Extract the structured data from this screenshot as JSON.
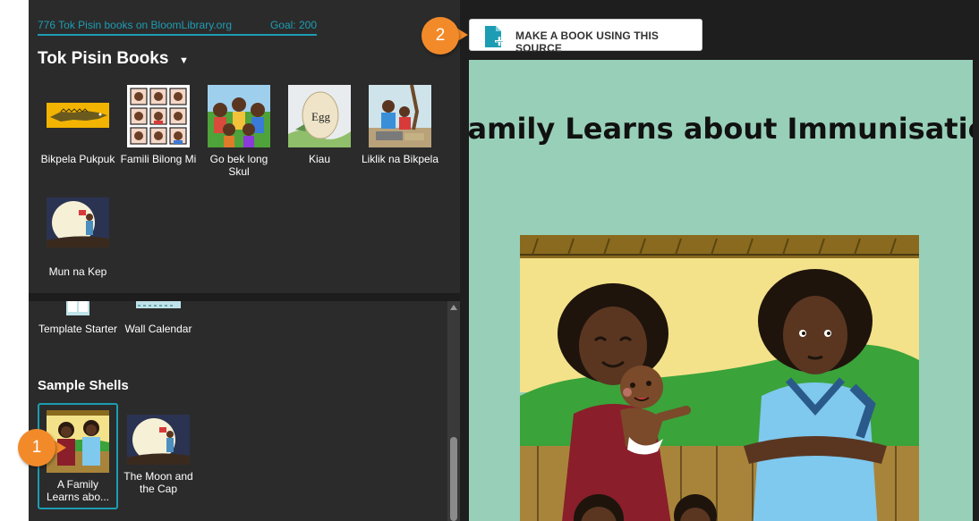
{
  "stats": {
    "count_text": "776 Tok Pisin books on BloomLibrary.org",
    "goal_text": "Goal: 200"
  },
  "collection": {
    "title": "Tok Pisin Books",
    "books": [
      {
        "label": "Bikpela Pukpuk"
      },
      {
        "label": "Famili Bilong Mi"
      },
      {
        "label": "Go bek long Skul"
      },
      {
        "label": "Kiau"
      },
      {
        "label": "Liklik na Bikpela"
      },
      {
        "label": "Mun na Kep"
      }
    ]
  },
  "templates": {
    "items": [
      {
        "label": "Template Starter"
      },
      {
        "label": "Wall Calendar"
      }
    ]
  },
  "shells": {
    "title": "Sample Shells",
    "items": [
      {
        "label": "A Family Learns abo..."
      },
      {
        "label": "The Moon and the Cap"
      }
    ]
  },
  "toolbar": {
    "make_book_label": "MAKE A BOOK USING THIS SOURCE"
  },
  "preview": {
    "title": "A Family Learns about Immunisations"
  },
  "egg_text": "Egg",
  "callouts": {
    "one": "1",
    "two": "2"
  },
  "colors": {
    "accent": "#1d9db3",
    "callout": "#f28a2a",
    "preview_bg": "#98cfb8",
    "panel_bg": "#2b2b2b"
  }
}
